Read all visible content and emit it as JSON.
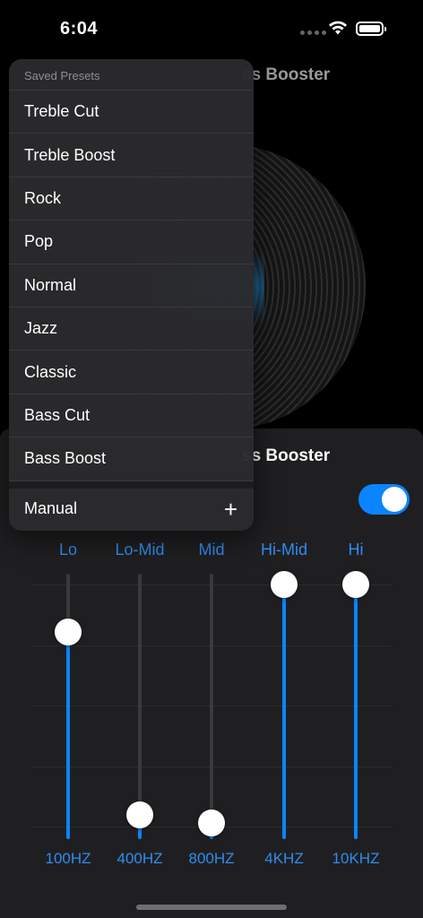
{
  "status": {
    "time": "6:04"
  },
  "background": {
    "title": "ss Booster"
  },
  "sheet": {
    "title": "ss Booster",
    "toggle_on": true,
    "bands": [
      {
        "label": "Lo",
        "freq": "100HZ",
        "level": 0.78
      },
      {
        "label": "Lo-Mid",
        "freq": "400HZ",
        "level": 0.09
      },
      {
        "label": "Mid",
        "freq": "800HZ",
        "level": 0.06
      },
      {
        "label": "Hi-Mid",
        "freq": "4KHZ",
        "level": 0.96
      },
      {
        "label": "Hi",
        "freq": "10KHZ",
        "level": 0.96
      }
    ]
  },
  "presets": {
    "header": "Saved Presets",
    "items": [
      "Treble Cut",
      "Treble Boost",
      "Rock",
      "Pop",
      "Normal",
      "Jazz",
      "Classic",
      "Bass Cut",
      "Bass Boost"
    ],
    "manual_label": "Manual",
    "add_icon": "+"
  },
  "colors": {
    "accent": "#0a84ff",
    "label": "#2f8cf0"
  }
}
